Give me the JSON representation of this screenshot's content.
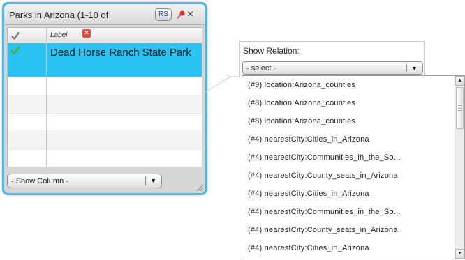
{
  "panel": {
    "title": "Parks in Arizona (1-10 of",
    "rs_label": "RS",
    "close_label": "×",
    "column_header": "Label",
    "remove_column_glyph": "×",
    "rows": [
      {
        "label": "Dead Horse Ranch State Park",
        "checked": true,
        "selected": true
      },
      {
        "label": "",
        "checked": false,
        "selected": false
      },
      {
        "label": "",
        "checked": false,
        "selected": false
      },
      {
        "label": "",
        "checked": false,
        "selected": false
      },
      {
        "label": "",
        "checked": false,
        "selected": false
      },
      {
        "label": "",
        "checked": false,
        "selected": false
      }
    ],
    "show_column": {
      "value": "- Show Column -",
      "arrow": "▼"
    }
  },
  "relation": {
    "title": "Show Relation:",
    "select_value": "- select -",
    "select_arrow": "▼",
    "options": [
      "(#9) location:Arizona_counties",
      "(#8) location:Arizona_counties",
      "(#8) location:Arizona_counties",
      "(#4) nearestCity:Cities_in_Arizona",
      "(#4) nearestCity:Communities_in_the_So...",
      "(#4) nearestCity:County_seats_in_Arizona",
      "(#4) nearestCity:Cities_in_Arizona",
      "(#4) nearestCity:Communities_in_the_So...",
      "(#4) nearestCity:County_seats_in_Arizona",
      "(#4) nearestCity:Cities_in_Arizona"
    ],
    "scroll_up": "▲",
    "scroll_down": "▼"
  },
  "colors": {
    "panel_border": "#46b8ea",
    "selected_row": "#2bc3f4",
    "check_green": "#4caf2a",
    "remove_red": "#e04b3a",
    "pin_red": "#d9342b"
  },
  "icons": {
    "header_check": "check-icon",
    "row_check": "check-icon",
    "pin": "pin-icon",
    "close": "close-icon",
    "remove_column": "remove-column-icon",
    "resize": "resize-grip-icon"
  }
}
